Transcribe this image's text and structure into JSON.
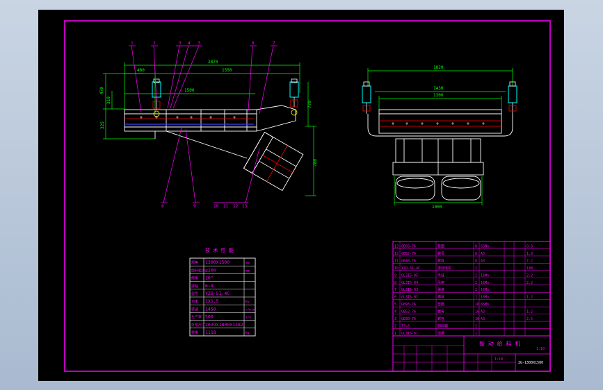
{
  "colors": {
    "background": "#000000",
    "frame": "#ff00ff",
    "outline": "#ffffff",
    "dimension": "#00ff00",
    "center_line": "#ff0000",
    "accent_blue": "#3b3bff",
    "cylinder": "#00ffff",
    "annotation": "#ff00ff"
  },
  "callouts": {
    "top": [
      "1",
      "2",
      "3",
      "4",
      "5",
      "6",
      "7"
    ],
    "bottom": [
      "8",
      "9",
      "10",
      "11",
      "12",
      "13"
    ]
  },
  "side_view": {
    "dims": {
      "overall_length": "2870",
      "left_offset": "400",
      "span_upper": "1550",
      "span_lower": "1500",
      "height_upper": "470",
      "height_mid": "310",
      "height_lower": "325",
      "right_height": "770",
      "chute_height": "780"
    }
  },
  "end_view": {
    "dims": {
      "outer_width": "1820",
      "mid_width": "1430",
      "inner_width": "1300",
      "base_width": "1000"
    }
  },
  "tech_table": {
    "title": "技 术 性 能",
    "rows": [
      {
        "label": "规格",
        "value": "1300X1500",
        "unit": "mm"
      },
      {
        "label": "给料粒度",
        "value": "≤200",
        "unit": "mm"
      },
      {
        "label": "倾角",
        "value": "10°",
        "unit": ""
      },
      {
        "label": "振幅",
        "value": "6~9",
        "unit": ""
      },
      {
        "label": "型号",
        "value": "YZO-5I-4C",
        "unit": ""
      },
      {
        "label": "功率",
        "value": "2X1.5",
        "unit": "Kw"
      },
      {
        "label": "转速",
        "value": "1450",
        "unit": "r/min"
      },
      {
        "label": "生产率",
        "value": "500",
        "unit": "t/h"
      },
      {
        "label": "外形尺寸",
        "value": "2039X1800X1382",
        "unit": ""
      },
      {
        "label": "重量",
        "value": "1118",
        "unit": "Kg"
      }
    ]
  },
  "parts_list": {
    "rows": [
      {
        "no": "13",
        "code": "GB93-76",
        "name": "垫圈",
        "qty": "8",
        "mat": "65Mn",
        "w": "0.6"
      },
      {
        "no": "12",
        "code": "GB52-76",
        "name": "螺母",
        "qty": "8",
        "mat": "A3",
        "w": "1.8"
      },
      {
        "no": "11",
        "code": "GB30-76",
        "name": "螺栓",
        "qty": "8",
        "mat": "A3",
        "w": "7.2"
      },
      {
        "no": "10",
        "code": "YZO-5I-4C",
        "name": "振动电机",
        "qty": "2",
        "mat": "",
        "w": "138"
      },
      {
        "no": "9",
        "code": "GL3I5-05",
        "name": "吊挂",
        "qty": "2",
        "mat": "16Mn",
        "w": "2.2"
      },
      {
        "no": "8",
        "code": "GL3I5-04",
        "name": "吊架",
        "qty": "2",
        "mat": "16Mn",
        "w": "2.2"
      },
      {
        "no": "7",
        "code": "GL3I5-03",
        "name": "弹簧",
        "qty": "2",
        "mat": "16Mn",
        "w": ""
      },
      {
        "no": "6",
        "code": "GL3I5-02",
        "name": "槽体",
        "qty": "1",
        "mat": "16Mn",
        "w": "1.2"
      },
      {
        "no": "5",
        "code": "GB93-76",
        "name": "垫圈",
        "qty": "16",
        "mat": "65Mn",
        "w": ""
      },
      {
        "no": "4",
        "code": "GB52-76",
        "name": "螺母",
        "qty": "16",
        "mat": "A3",
        "w": "1.2"
      },
      {
        "no": "3",
        "code": "GB30-76",
        "name": "螺栓",
        "qty": "16",
        "mat": "A3",
        "w": "2.5"
      },
      {
        "no": "2",
        "code": "TJ-6",
        "name": "卸料器",
        "qty": "2",
        "mat": "",
        "w": ""
      },
      {
        "no": "1",
        "code": "GL3I5-01",
        "name": "溜槽",
        "qty": "1",
        "mat": "",
        "w": ""
      }
    ]
  },
  "title_block": {
    "title": "振 动 给 料 机",
    "scale": "1:10",
    "drawing_no": "ZG-1300X1500",
    "sheet": "1:10"
  }
}
